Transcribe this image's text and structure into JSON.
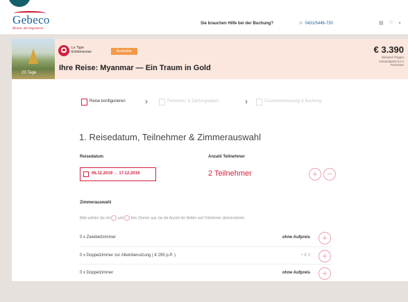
{
  "header": {
    "logo_text": "Gebeco",
    "logo_tagline": "Reisen, die begeistern.",
    "help_text": "Sie brauchen Hilfe bei der Buchung?",
    "phone": "0431/5446-730",
    "icons": [
      "print-icon",
      "heart-icon",
      "lock-icon"
    ]
  },
  "trip": {
    "image_caption": "23 Tage",
    "badge_text_line1": "Le Tigre",
    "badge_text_line2": "Erlebnisreise",
    "badge_label": "Bestseller",
    "title": "Ihre Reise: Myanmar — Ein Traum in Gold",
    "price": "€ 3.390",
    "price_note": "inklusive Flugen Gesamtpreis fur 2 Personen"
  },
  "steps": [
    {
      "label": "Reise konfigurieren",
      "active": true
    },
    {
      "label": "Personen- & Zahlungsdaten",
      "active": false
    },
    {
      "label": "Zusammenfassung & Buchung",
      "active": false
    }
  ],
  "main": {
    "section_title": "1. Reisedatum, Teilnehmer & Zimmerauswahl",
    "date_label": "Reisedatum",
    "date_value": "06.12.2019  →  17.12.2019",
    "people_label": "Anzahl Teilnehmer",
    "people_value": "2 Teilnehmer",
    "plus_symbol": "+",
    "minus_symbol": "−",
    "room_label": "Zimmerauswahl",
    "room_hint_a": "Bitte wählen Sie mit",
    "room_hint_b": "und",
    "room_hint_c": "Ihre Zimmer aus, bis die Anzahl der Betten und Teilnehmer übereinstimmt.",
    "rooms": [
      {
        "name": "0 x Zweibettzimmer",
        "price": "ohne Aufpreis"
      },
      {
        "name": "0 x Doppelzimmer zur Alleinbenutzung ( € 295 p.P. )",
        "price": "+ € 0"
      },
      {
        "name": "0 x Doppelzimmer",
        "price": "ohne Aufpreis"
      }
    ]
  },
  "colors": {
    "accent": "#d3203f",
    "brand_blue": "#1b5e96",
    "trip_bar": "#fbe7dd",
    "page_bg": "#e6e1dc"
  }
}
